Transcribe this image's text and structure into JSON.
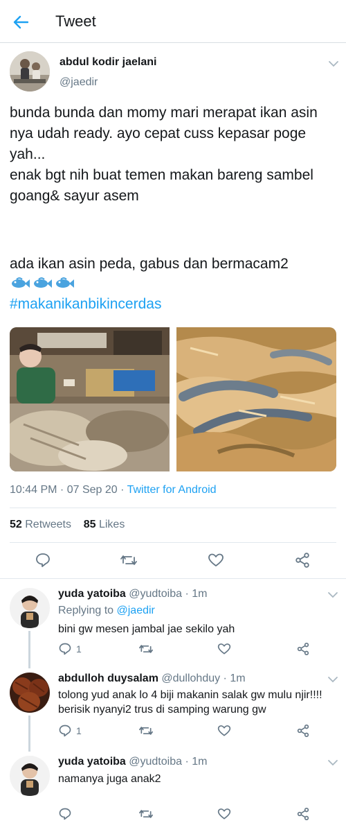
{
  "header": {
    "title": "Tweet"
  },
  "tweet": {
    "author_name": "abdul kodir jaelani",
    "author_handle": "@jaedir",
    "text_1": "bunda bunda dan momy mari merapat ikan asin nya udah ready. ayo cepat cuss kepasar poge yah...\nenak bgt nih buat temen makan bareng sambel goang& sayur asem",
    "text_2": "ada ikan asin peda, gabus dan bermacam2",
    "emojis": [
      "🐟",
      "🐟",
      "🐟"
    ],
    "hashtag": "#makanikanbikincerdas",
    "time": "10:44 PM · 07 Sep 20 · ",
    "source": "Twitter for Android",
    "retweets_count": "52",
    "retweets_label": " Retweets",
    "likes_count": "85",
    "likes_label": " Likes"
  },
  "replies": [
    {
      "name": "yuda yatoiba",
      "handle": " @yudtoiba · 1m",
      "replying_label": "Replying to ",
      "replying_to": "@jaedir",
      "text": "bini gw mesen jambal jae sekilo yah",
      "reply_count": "1"
    },
    {
      "name": "abdulloh duysalam",
      "handle": " @dullohduy · 1m",
      "text": "tolong yud anak lo 4 biji makanin salak gw mulu njir!!!! berisik nyanyi2 trus di samping warung gw",
      "reply_count": "1"
    },
    {
      "name": "yuda yatoiba",
      "handle": " @yudtoiba · 1m",
      "text": "namanya juga anak2",
      "reply_count": ""
    }
  ],
  "icons": {
    "back": "arrow-left-icon",
    "more": "chevron-down-icon",
    "reply": "reply-bubble-icon",
    "retweet": "retweet-icon",
    "like": "heart-icon",
    "share": "share-icon"
  },
  "colors": {
    "accent": "#1da1f2",
    "text": "#14171a",
    "secondary": "#657786",
    "divider": "#e1e8ed"
  }
}
